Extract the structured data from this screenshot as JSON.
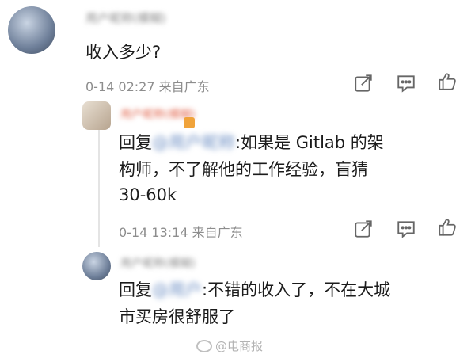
{
  "comments": [
    {
      "username": "用户昵称(模糊)",
      "text": "收入多少?",
      "meta": "0-14 02:27 来自广东"
    },
    {
      "username": "用户昵称(模糊)",
      "reply_prefix": "回复",
      "reply_target": "@用户昵称",
      "text_line1": ":如果是 Gitlab 的架",
      "text_line2": "构师，不了解他的工作经验，盲猜",
      "text_line3": "30-60k",
      "meta": "0-14 13:14 来自广东"
    },
    {
      "username": "用户昵称(模糊)",
      "reply_prefix": "回复",
      "reply_target": "@用户",
      "text_line1": ":不错的收入了，不在大城",
      "text_line2": "市买房很舒服了"
    }
  ],
  "watermark": "@电商报",
  "icons": [
    "share-icon",
    "comment-icon",
    "like-icon"
  ]
}
